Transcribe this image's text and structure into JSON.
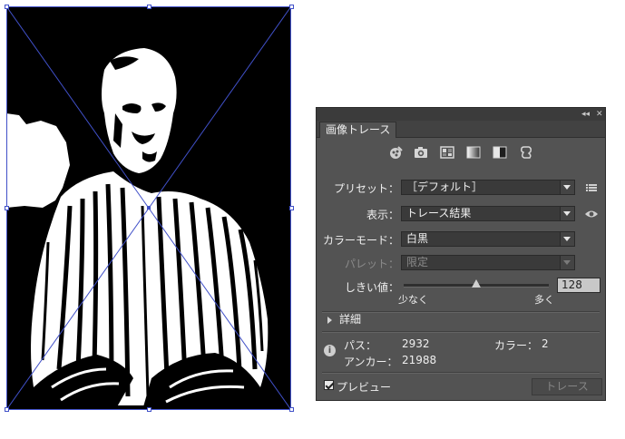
{
  "artwork": {
    "description_icon": "traced-photo"
  },
  "panel": {
    "collapse_glyph": "◂◂",
    "close_glyph": "✕",
    "tab_label": "画像トレース",
    "mode_icons": [
      "auto-color-icon",
      "high-color-icon",
      "low-color-icon",
      "grayscale-icon",
      "black-white-icon",
      "outline-icon"
    ],
    "preset": {
      "label": "プリセット：",
      "value": "［デフォルト］",
      "menu_icon": "list-icon"
    },
    "view": {
      "label": "表示：",
      "value": "トレース結果",
      "eye_icon": "eye-icon"
    },
    "color_mode": {
      "label": "カラーモード：",
      "value": "白黒"
    },
    "palette": {
      "label": "パレット：",
      "value": "限定"
    },
    "threshold": {
      "label": "しきい値：",
      "value": "128",
      "level": 128,
      "min": 0,
      "max": 255,
      "less_label": "少なく",
      "more_label": "多く"
    },
    "advanced": {
      "label": "詳細"
    },
    "info": {
      "paths_label": "パス：",
      "paths_value": "2932",
      "colors_label": "カラー：",
      "colors_value": "2",
      "anchors_label": "アンカー：",
      "anchors_value": "21988"
    },
    "preview": {
      "label": "プレビュー",
      "checked": true
    },
    "trace_button": "トレース"
  },
  "colors": {
    "panel_bg": "#535353",
    "field_bg": "#3a3a3a",
    "selection": "#4050c8"
  }
}
